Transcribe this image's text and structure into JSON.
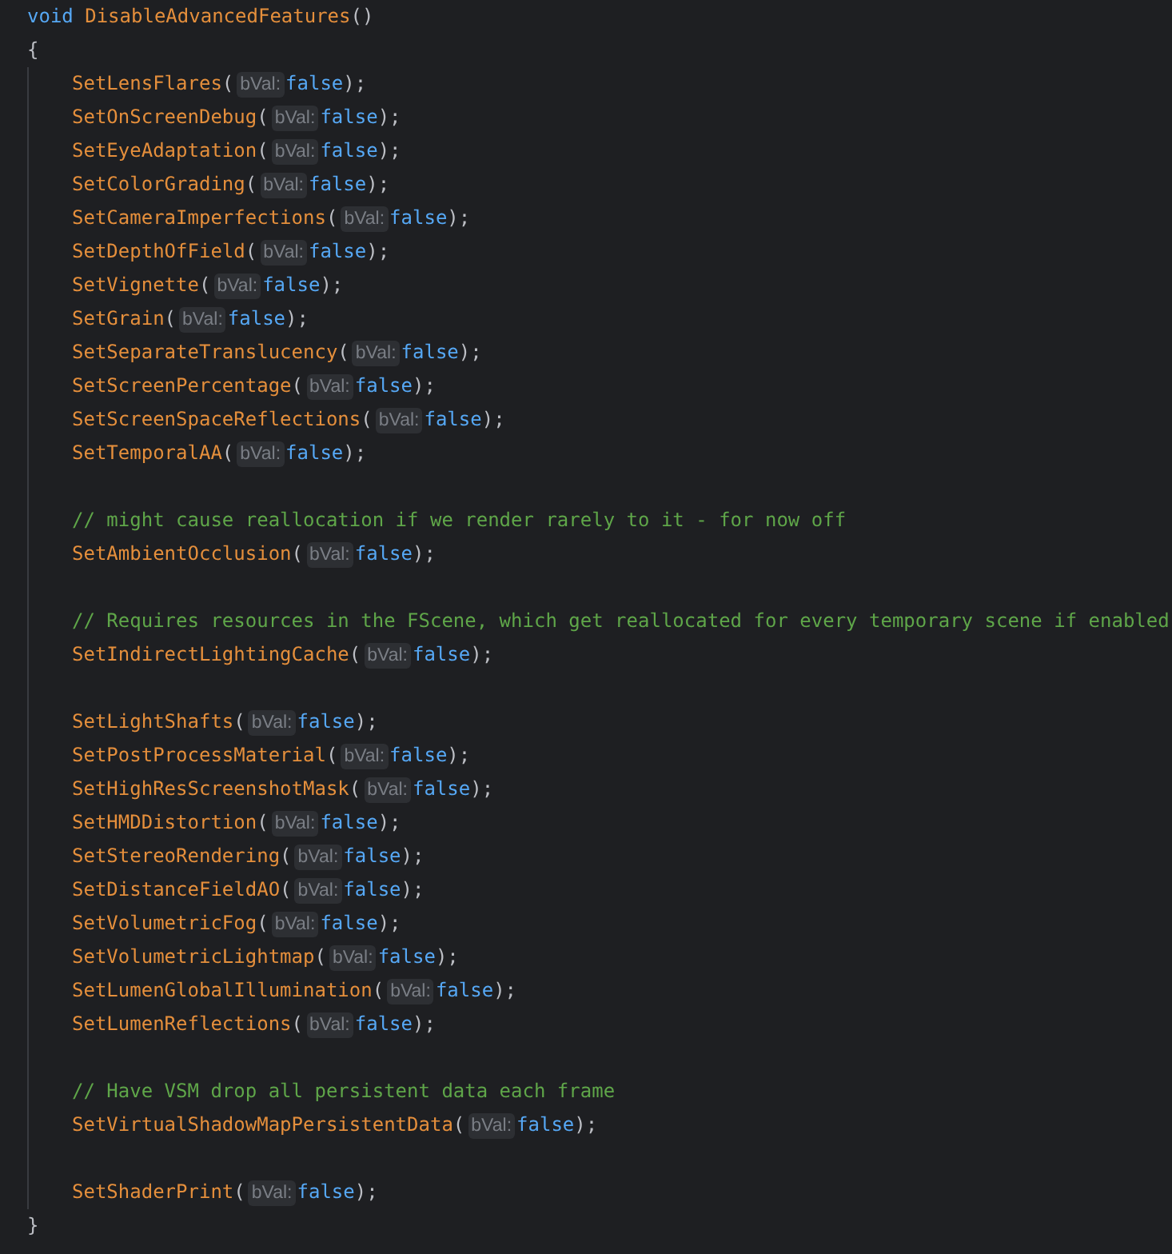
{
  "editor": {
    "lines": [
      {
        "kind": "signature",
        "keyword": "void",
        "name": "DisableAdvancedFeatures",
        "parens": "()"
      },
      {
        "kind": "brace",
        "text": "{"
      },
      {
        "kind": "call",
        "name": "SetLensFlares",
        "open": "(",
        "hint": "bVal:",
        "value": "false",
        "close": ");"
      },
      {
        "kind": "call",
        "name": "SetOnScreenDebug",
        "open": "(",
        "hint": "bVal:",
        "value": "false",
        "close": ");"
      },
      {
        "kind": "call",
        "name": "SetEyeAdaptation",
        "open": "(",
        "hint": "bVal:",
        "value": "false",
        "close": ");"
      },
      {
        "kind": "call",
        "name": "SetColorGrading",
        "open": "(",
        "hint": "bVal:",
        "value": "false",
        "close": ");"
      },
      {
        "kind": "call",
        "name": "SetCameraImperfections",
        "open": "(",
        "hint": "bVal:",
        "value": "false",
        "close": ");"
      },
      {
        "kind": "call",
        "name": "SetDepthOfField",
        "open": "(",
        "hint": "bVal:",
        "value": "false",
        "close": ");"
      },
      {
        "kind": "call",
        "name": "SetVignette",
        "open": "(",
        "hint": "bVal:",
        "value": "false",
        "close": ");"
      },
      {
        "kind": "call",
        "name": "SetGrain",
        "open": "(",
        "hint": "bVal:",
        "value": "false",
        "close": ");"
      },
      {
        "kind": "call",
        "name": "SetSeparateTranslucency",
        "open": "(",
        "hint": "bVal:",
        "value": "false",
        "close": ");"
      },
      {
        "kind": "call",
        "name": "SetScreenPercentage",
        "open": "(",
        "hint": "bVal:",
        "value": "false",
        "close": ");"
      },
      {
        "kind": "call",
        "name": "SetScreenSpaceReflections",
        "open": "(",
        "hint": "bVal:",
        "value": "false",
        "close": ");"
      },
      {
        "kind": "call",
        "name": "SetTemporalAA",
        "open": "(",
        "hint": "bVal:",
        "value": "false",
        "close": ");"
      },
      {
        "kind": "blank"
      },
      {
        "kind": "comment",
        "text": "// might cause reallocation if we render rarely to it - for now off"
      },
      {
        "kind": "call",
        "name": "SetAmbientOcclusion",
        "open": "(",
        "hint": "bVal:",
        "value": "false",
        "close": ");"
      },
      {
        "kind": "blank"
      },
      {
        "kind": "comment",
        "text": "// Requires resources in the FScene, which get reallocated for every temporary scene if enabled"
      },
      {
        "kind": "call",
        "name": "SetIndirectLightingCache",
        "open": "(",
        "hint": "bVal:",
        "value": "false",
        "close": ");"
      },
      {
        "kind": "blank"
      },
      {
        "kind": "call",
        "name": "SetLightShafts",
        "open": "(",
        "hint": "bVal:",
        "value": "false",
        "close": ");"
      },
      {
        "kind": "call",
        "name": "SetPostProcessMaterial",
        "open": "(",
        "hint": "bVal:",
        "value": "false",
        "close": ");"
      },
      {
        "kind": "call",
        "name": "SetHighResScreenshotMask",
        "open": "(",
        "hint": "bVal:",
        "value": "false",
        "close": ");"
      },
      {
        "kind": "call",
        "name": "SetHMDDistortion",
        "open": "(",
        "hint": "bVal:",
        "value": "false",
        "close": ");"
      },
      {
        "kind": "call",
        "name": "SetStereoRendering",
        "open": "(",
        "hint": "bVal:",
        "value": "false",
        "close": ");"
      },
      {
        "kind": "call",
        "name": "SetDistanceFieldAO",
        "open": "(",
        "hint": "bVal:",
        "value": "false",
        "close": ");"
      },
      {
        "kind": "call",
        "name": "SetVolumetricFog",
        "open": "(",
        "hint": "bVal:",
        "value": "false",
        "close": ");"
      },
      {
        "kind": "call",
        "name": "SetVolumetricLightmap",
        "open": "(",
        "hint": "bVal:",
        "value": "false",
        "close": ");"
      },
      {
        "kind": "call",
        "name": "SetLumenGlobalIllumination",
        "open": "(",
        "hint": "bVal:",
        "value": "false",
        "close": ");"
      },
      {
        "kind": "call",
        "name": "SetLumenReflections",
        "open": "(",
        "hint": "bVal:",
        "value": "false",
        "close": ");"
      },
      {
        "kind": "blank"
      },
      {
        "kind": "comment",
        "text": "// Have VSM drop all persistent data each frame"
      },
      {
        "kind": "call",
        "name": "SetVirtualShadowMapPersistentData",
        "open": "(",
        "hint": "bVal:",
        "value": "false",
        "close": ");"
      },
      {
        "kind": "blank"
      },
      {
        "kind": "call",
        "name": "SetShaderPrint",
        "open": "(",
        "hint": "bVal:",
        "value": "false",
        "close": ");"
      },
      {
        "kind": "brace",
        "text": "}"
      }
    ]
  }
}
